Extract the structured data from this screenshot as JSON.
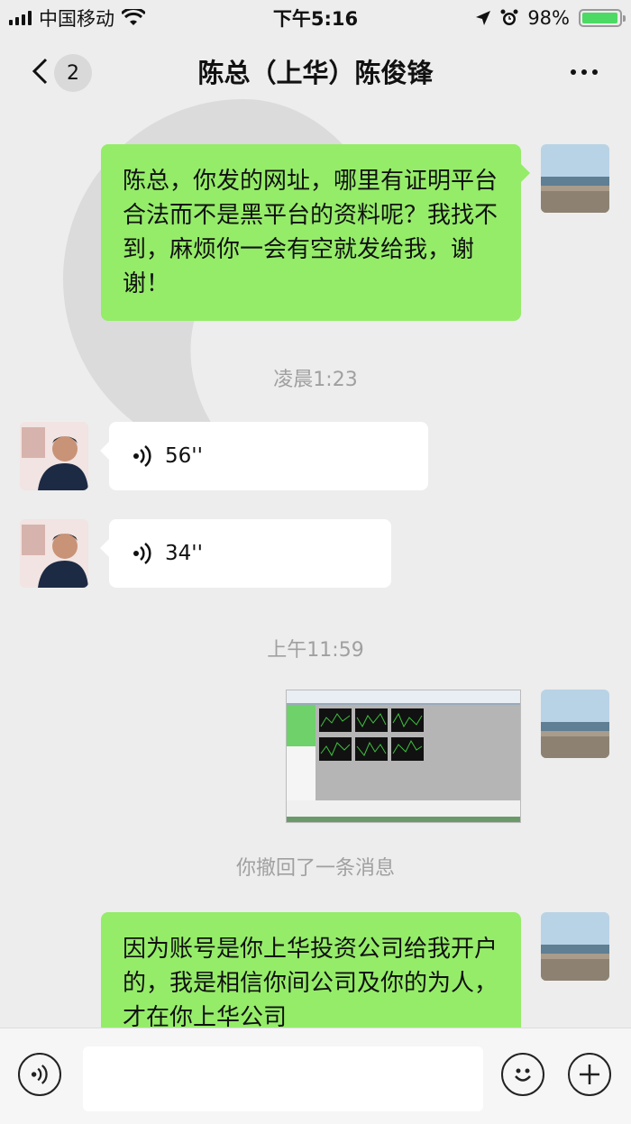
{
  "status_bar": {
    "carrier": "中国移动",
    "time": "下午5:16",
    "battery": "98%",
    "battery_level": 0.98
  },
  "nav": {
    "unread_count": "2",
    "title": "陈总（上华）陈俊锋"
  },
  "messages": [
    {
      "type": "text",
      "side": "right",
      "text": "陈总，你发的网址，哪里有证明平台合法而不是黑平台的资料呢？我找不到，麻烦你一会有空就发给我，谢谢！"
    },
    {
      "type": "time",
      "text": "凌晨1:23"
    },
    {
      "type": "voice",
      "side": "left",
      "duration": "56''"
    },
    {
      "type": "voice",
      "side": "left",
      "duration": "34''"
    },
    {
      "type": "time",
      "text": "上午11:59"
    },
    {
      "type": "image",
      "side": "right"
    },
    {
      "type": "system",
      "text": "你撤回了一条消息"
    },
    {
      "type": "text",
      "side": "right",
      "text": "因为账号是你上华投资公司给我开户的，我是相信你间公司及你的为人，才在你上华公司"
    }
  ],
  "colors": {
    "bubble_self": "#95ec69",
    "bubble_other": "#ffffff",
    "background": "#ededed"
  }
}
